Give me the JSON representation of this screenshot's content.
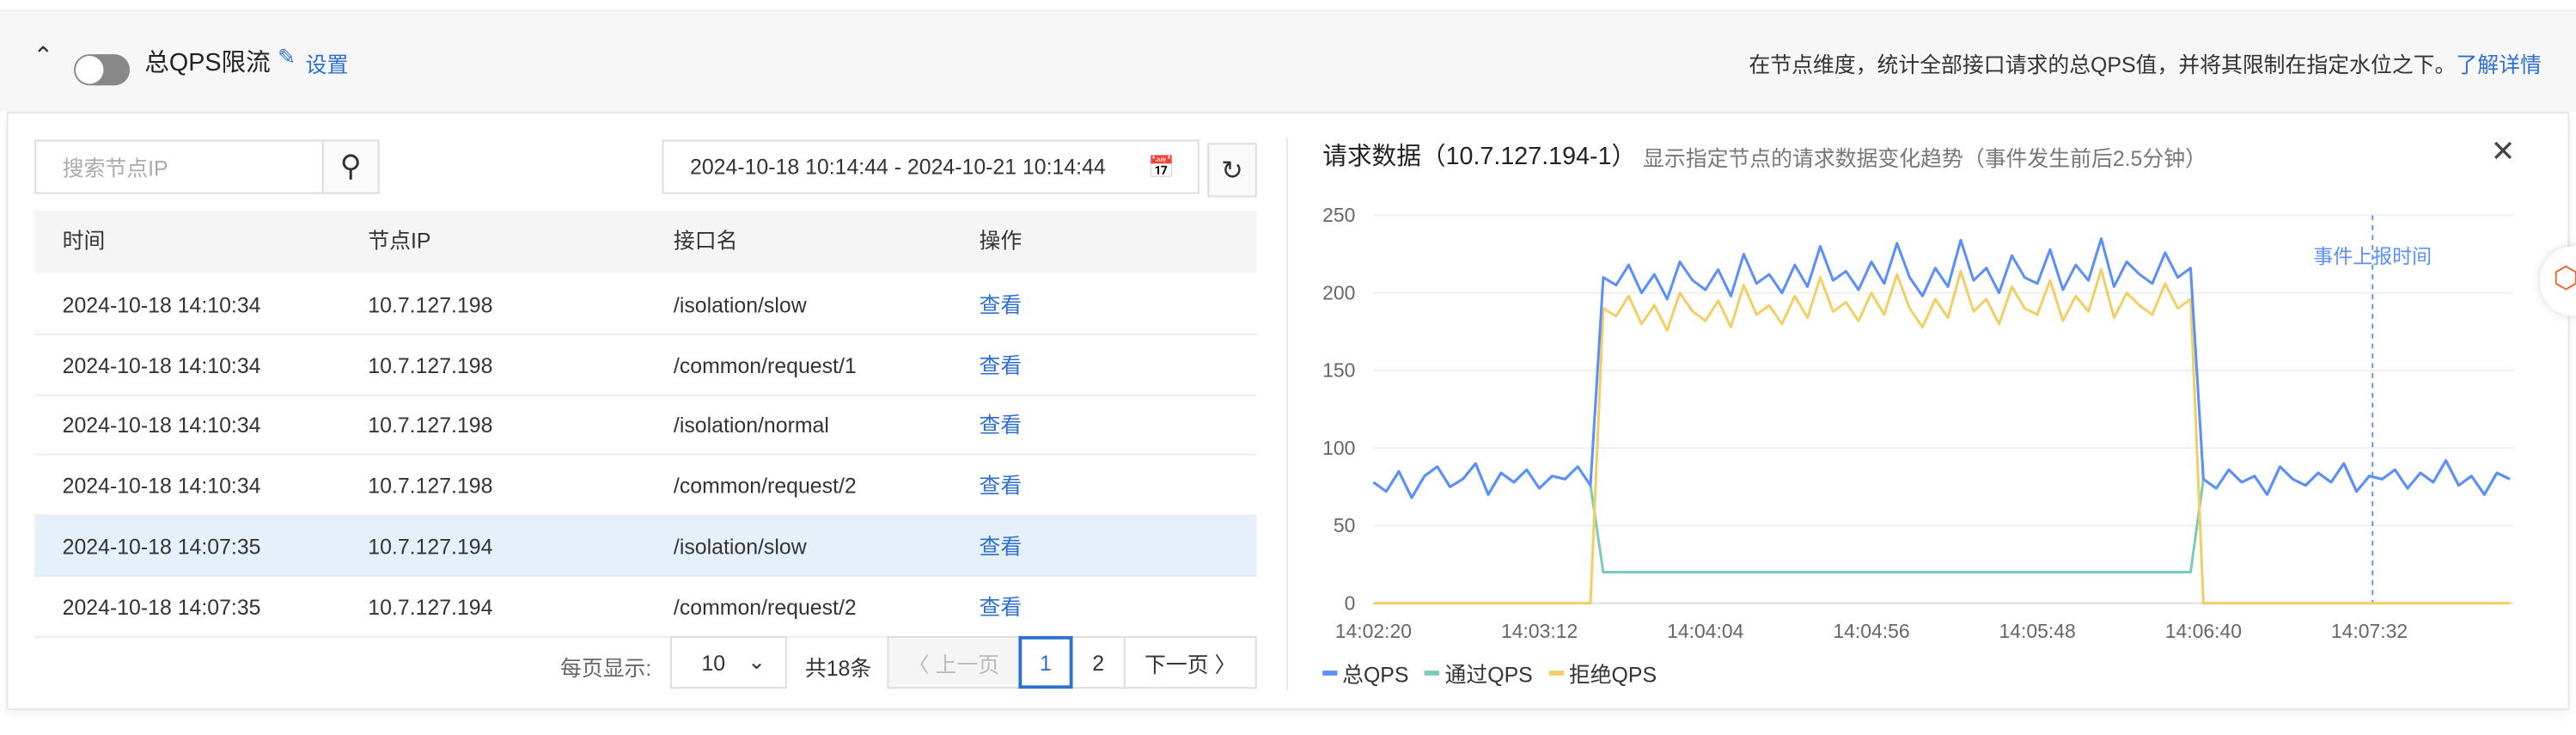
{
  "header": {
    "title": "总QPS限流",
    "enabled": false,
    "settings_label": "设置",
    "description": "在节点维度，统计全部接口请求的总QPS值，并将其限制在指定水位之下。",
    "learn_more": "了解详情"
  },
  "filters": {
    "search_placeholder": "搜索节点IP",
    "search_value": "",
    "date_range": "2024-10-18 10:14:44 - 2024-10-21 10:14:44"
  },
  "table": {
    "columns": [
      "时间",
      "节点IP",
      "接口名",
      "操作"
    ],
    "rows": [
      {
        "time": "2024-10-18 14:10:34",
        "ip": "10.7.127.198",
        "api": "/isolation/slow",
        "action": "查看"
      },
      {
        "time": "2024-10-18 14:10:34",
        "ip": "10.7.127.198",
        "api": "/common/request/1",
        "action": "查看"
      },
      {
        "time": "2024-10-18 14:10:34",
        "ip": "10.7.127.198",
        "api": "/isolation/normal",
        "action": "查看"
      },
      {
        "time": "2024-10-18 14:10:34",
        "ip": "10.7.127.198",
        "api": "/common/request/2",
        "action": "查看"
      },
      {
        "time": "2024-10-18 14:07:35",
        "ip": "10.7.127.194",
        "api": "/isolation/slow",
        "action": "查看",
        "selected": true
      },
      {
        "time": "2024-10-18 14:07:35",
        "ip": "10.7.127.194",
        "api": "/common/request/2",
        "action": "查看"
      }
    ]
  },
  "pagination": {
    "page_size_label": "每页显示:",
    "page_size": "10",
    "total": "共18条",
    "prev": "上一页",
    "pages": [
      "1",
      "2"
    ],
    "current": "1",
    "next": "下一页"
  },
  "detail": {
    "title": "请求数据（10.7.127.194-1）",
    "subtitle": "显示指定节点的请求数据变化趋势（事件发生前后2.5分钟）"
  },
  "chart_data": {
    "type": "line",
    "x_start": "14:02:20",
    "x_step_seconds": 4,
    "x_tick_labels": [
      "14:02:20",
      "14:03:12",
      "14:04:04",
      "14:04:56",
      "14:05:48",
      "14:06:40",
      "14:07:32"
    ],
    "y_ticks": [
      "0",
      "50",
      "100",
      "150",
      "200",
      "250"
    ],
    "ylim": [
      0,
      250
    ],
    "grid": true,
    "legend_position": "bottom-left",
    "event_marker": {
      "label": "事件上报时间",
      "time": "14:07:33"
    },
    "colors": {
      "total": "#5b8ff9",
      "pass": "#7ecab9",
      "reject": "#f2cf66"
    },
    "series": [
      {
        "key": "total",
        "name": "总QPS",
        "note": "pass + reject"
      },
      {
        "key": "pass",
        "name": "通过QPS",
        "values": [
          78,
          72,
          85,
          68,
          82,
          88,
          75,
          80,
          90,
          70,
          84,
          78,
          86,
          74,
          82,
          80,
          88,
          76,
          20,
          20,
          20,
          20,
          20,
          20,
          20,
          20,
          20,
          20,
          20,
          20,
          20,
          20,
          20,
          20,
          20,
          20,
          20,
          20,
          20,
          20,
          20,
          20,
          20,
          20,
          20,
          20,
          20,
          20,
          20,
          20,
          20,
          20,
          20,
          20,
          20,
          20,
          20,
          20,
          20,
          20,
          20,
          20,
          20,
          20,
          20,
          80,
          74,
          86,
          78,
          82,
          70,
          88,
          80,
          76,
          84,
          78,
          90,
          72,
          82,
          80,
          86,
          74,
          84,
          78,
          92,
          76,
          82,
          70,
          84,
          80
        ]
      },
      {
        "key": "reject",
        "name": "拒绝QPS",
        "values": [
          0,
          0,
          0,
          0,
          0,
          0,
          0,
          0,
          0,
          0,
          0,
          0,
          0,
          0,
          0,
          0,
          0,
          0,
          190,
          185,
          198,
          180,
          192,
          176,
          200,
          188,
          182,
          195,
          178,
          205,
          186,
          192,
          180,
          198,
          184,
          210,
          188,
          194,
          182,
          200,
          186,
          212,
          190,
          178,
          196,
          184,
          214,
          188,
          196,
          180,
          204,
          190,
          186,
          208,
          182,
          198,
          188,
          215,
          184,
          200,
          192,
          186,
          206,
          190,
          196,
          0,
          0,
          0,
          0,
          0,
          0,
          0,
          0,
          0,
          0,
          0,
          0,
          0,
          0,
          0,
          0,
          0,
          0,
          0,
          0,
          0,
          0,
          0,
          0,
          0
        ]
      }
    ]
  }
}
